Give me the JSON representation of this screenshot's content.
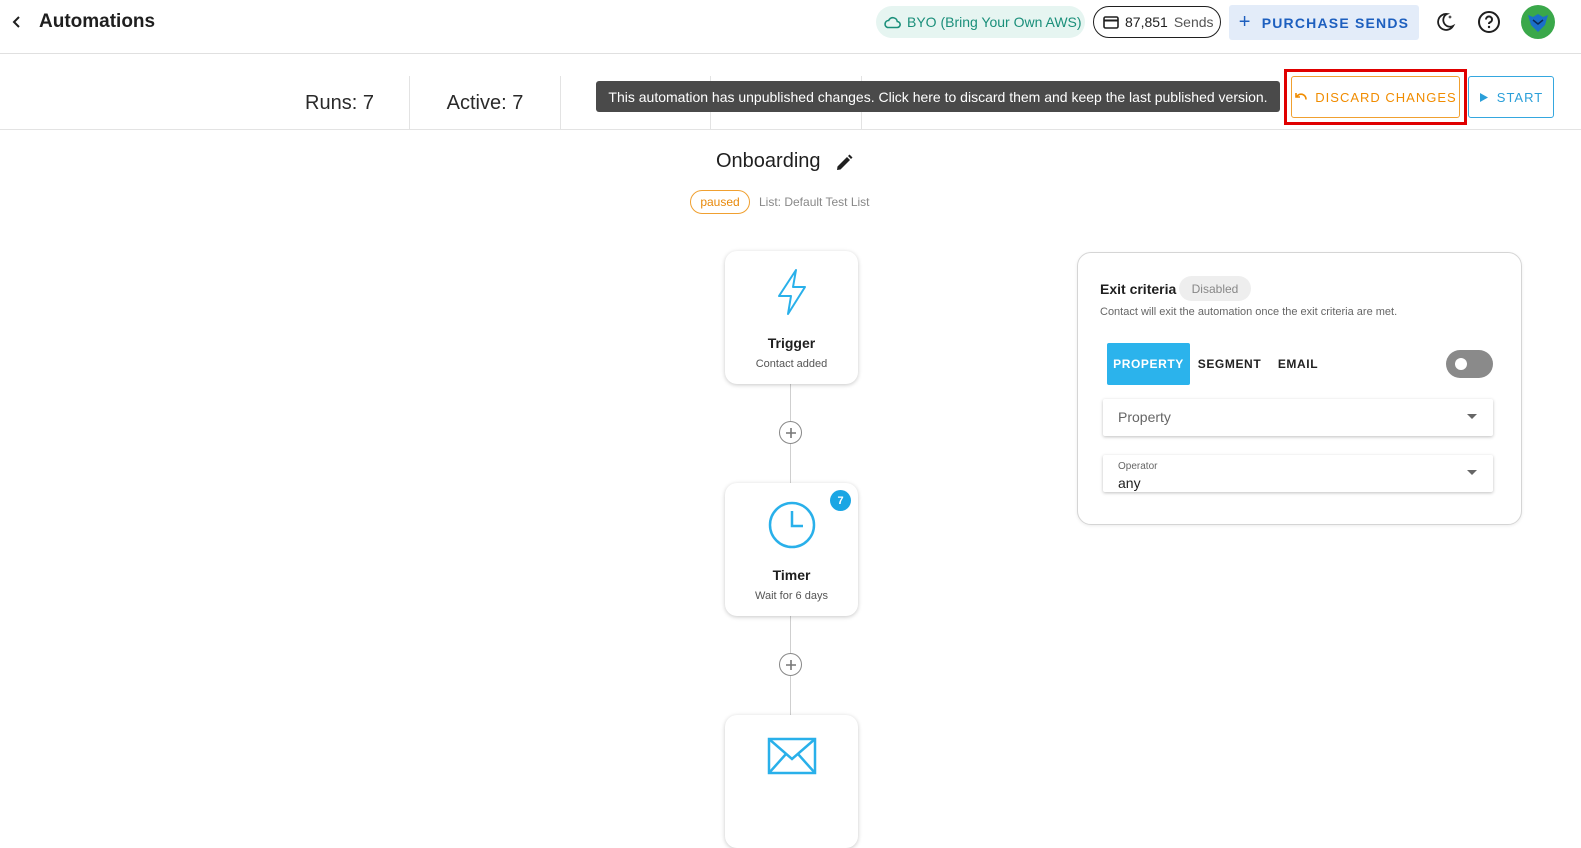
{
  "header": {
    "title": "Automations",
    "byo_label": "BYO (Bring Your Own AWS)",
    "sends_count": "87,851",
    "sends_label": "Sends",
    "purchase_label": "PURCHASE SENDS"
  },
  "stats": {
    "runs": "Runs: 7",
    "active": "Active: 7"
  },
  "tooltip": "This automation has unpublished changes. Click here to discard them and keep the last published version.",
  "actions": {
    "discard_label": "DISCARD CHANGES",
    "start_label": "START"
  },
  "automation": {
    "name": "Onboarding",
    "status": "paused",
    "list": "List: Default Test List"
  },
  "nodes": [
    {
      "title": "Trigger",
      "subtitle": "Contact added",
      "icon": "lightning-icon"
    },
    {
      "title": "Timer",
      "subtitle": "Wait for 6 days",
      "icon": "clock-icon",
      "badge": "7"
    },
    {
      "title": "",
      "subtitle": "",
      "icon": "envelope-icon"
    }
  ],
  "exit_criteria": {
    "title": "Exit criteria",
    "state": "Disabled",
    "description": "Contact will exit the automation once the exit criteria are met.",
    "tabs": [
      "PROPERTY",
      "SEGMENT",
      "EMAIL"
    ],
    "active_tab": "PROPERTY",
    "enabled": false,
    "property_placeholder": "Property",
    "operator_label": "Operator",
    "operator_value": "any"
  },
  "colors": {
    "accent": "#2bb3ec",
    "warning": "#f08c00",
    "highlight": "#e00000"
  }
}
